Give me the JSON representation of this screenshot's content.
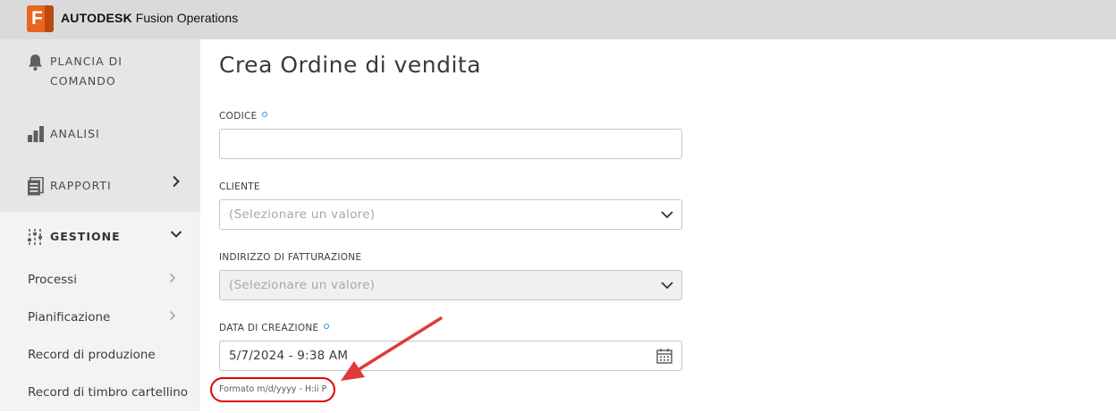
{
  "app": {
    "logo_letter": "F",
    "brand_bold": "AUTODESK",
    "brand_rest": " Fusion Operations",
    "accent_color": "#e8661d"
  },
  "sidebar": {
    "top_items": [
      {
        "label": "PLANCIA DI COMANDO",
        "icon": "bell-icon"
      },
      {
        "label": "ANALISI",
        "icon": "bar-chart-icon"
      },
      {
        "label": "RAPPORTI",
        "icon": "reports-icon",
        "chevron": "›"
      },
      {
        "label": "GESTIONE",
        "icon": "sliders-icon",
        "chevron": "⌄",
        "expanded": true
      }
    ],
    "sub_items": [
      {
        "label": "Processi",
        "chevron": "›"
      },
      {
        "label": "Pianificazione",
        "chevron": "›"
      },
      {
        "label": "Record di produzione"
      },
      {
        "label": "Record di timbro cartellino"
      }
    ]
  },
  "main": {
    "title": "Crea Ordine di vendita",
    "fields": {
      "codice": {
        "label": "CODICE",
        "required": true,
        "value": ""
      },
      "cliente": {
        "label": "CLIENTE",
        "placeholder": "(Selezionare un valore)"
      },
      "indirizzo": {
        "label": "INDIRIZZO DI FATTURAZIONE",
        "placeholder": "(Selezionare un valore)",
        "disabled": true
      },
      "data": {
        "label": "DATA DI CREAZIONE",
        "required": true,
        "value": "5/7/2024 - 9:38 AM",
        "hint": "Formato m/d/yyyy - H:ii P"
      }
    },
    "annotation_color": "#e03a3a"
  }
}
